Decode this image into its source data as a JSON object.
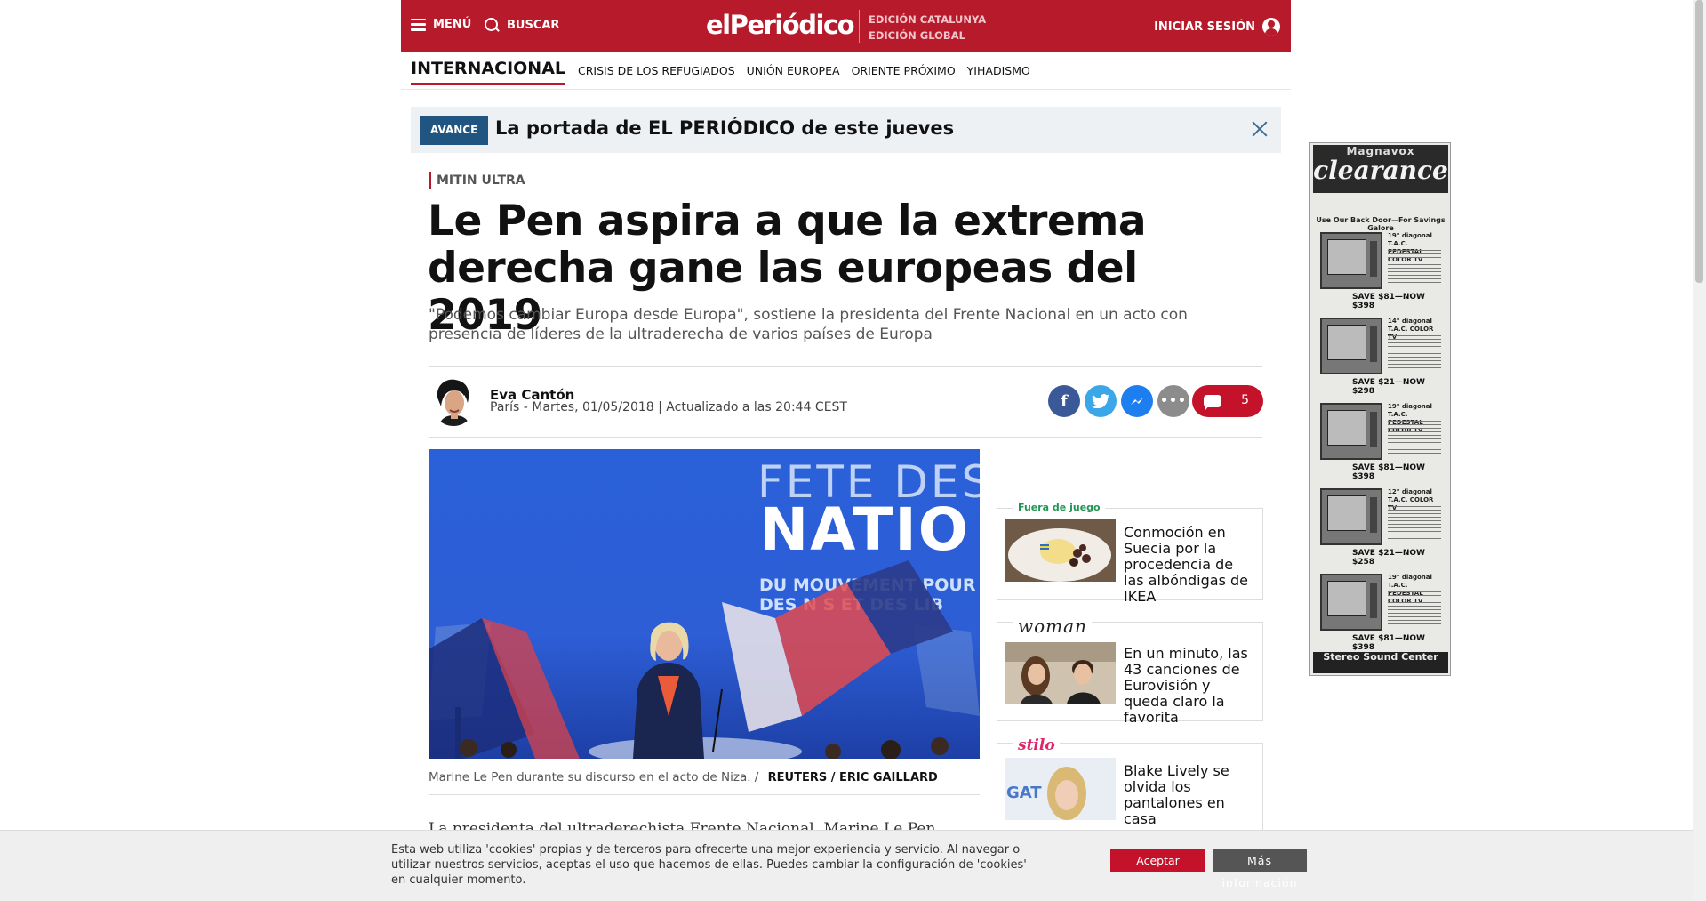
{
  "header": {
    "menu_label": "MENÚ",
    "search_label": "BUSCAR",
    "logo": "elPeriódico",
    "edition_1": "EDICIÓN CATALUNYA",
    "edition_2": "EDICIÓN GLOBAL",
    "login_label": "INICIAR SESIÓN",
    "brand_color": "#b71a2b"
  },
  "section_nav": {
    "title": "INTERNACIONAL",
    "links": [
      "CRISIS DE LOS REFUGIADOS",
      "UNIÓN EUROPEA",
      "ORIENTE PRÓXIMO",
      "YIHADISMO"
    ]
  },
  "breaking": {
    "badge": "AVANCE",
    "text": "La portada de EL PERIÓDICO de este jueves"
  },
  "article": {
    "kicker": "MITIN ULTRA",
    "headline": "Le Pen aspira a que la extrema derecha gane las europeas del 2019",
    "subtitle": "\"Podemos cambiar Europa desde Europa\", sostiene la presidenta del Frente Nacional en un acto con presencia de líderes de la ultraderecha de varios países de Europa",
    "author": "Eva Cantón",
    "dateline": "París - Martes, 01/05/2018 | Actualizado a las 20:44 CEST",
    "comment_count": "5",
    "photo_text": {
      "line1": "FETE DES",
      "line2": "NATIO",
      "line3": "DU MOUVEMENT POUR UN",
      "line4": "DES N    S ET DES LIB"
    },
    "caption": "Marine Le Pen durante su discurso en el acto de Niza. /",
    "credit": "REUTERS / ERIC GAILLARD",
    "body_start": "La presidenta del ultraderechista Frente Nacional, Marine Le Pen,"
  },
  "share": {
    "facebook_icon": "f",
    "more_icon": "•••"
  },
  "promos": [
    {
      "brand": "Fuera de juego",
      "text": "Conmoción en Suecia por la procedencia de las albóndigas de IKEA"
    },
    {
      "brand": "woman",
      "text": "En un minuto, las 43 canciones de Eurovisión y queda claro la favorita"
    },
    {
      "brand": "stilo",
      "text": "Blake Lively se olvida los pantalones en casa",
      "thumb_text": "GAT"
    }
  ],
  "ad": {
    "top_small": "Magnavox",
    "top_big": "clearance",
    "tagline": "Use Our Back Door—For Savings Galore",
    "items": [
      {
        "spec": "19\" diagonal T.A.C. PEDESTAL COLOR TV",
        "save": "SAVE $81—NOW $398"
      },
      {
        "spec": "14\" diagonal T.A.C. COLOR TV",
        "save": "SAVE $21—NOW $298"
      },
      {
        "spec": "19\" diagonal T.A.C. PEDESTAL COLOR TV",
        "save": "SAVE $81—NOW $398"
      },
      {
        "spec": "12\" diagonal T.A.C. COLOR TV",
        "save": "SAVE $21—NOW $258"
      },
      {
        "spec": "19\" diagonal T.A.C. PEDESTAL COLOR TV",
        "save": "SAVE $81—NOW $398"
      }
    ],
    "bottom": "Stereo Sound Center"
  },
  "cookie": {
    "message": "Esta web utiliza 'cookies' propias y de terceros para ofrecerte una mejor experiencia y servicio. Al navegar o utilizar nuestros servicios, aceptas el uso que hacemos de ellas. Puedes cambiar la configuración de 'cookies' en cualquier momento.",
    "accept_label": "Aceptar",
    "more_label": "Más información"
  }
}
